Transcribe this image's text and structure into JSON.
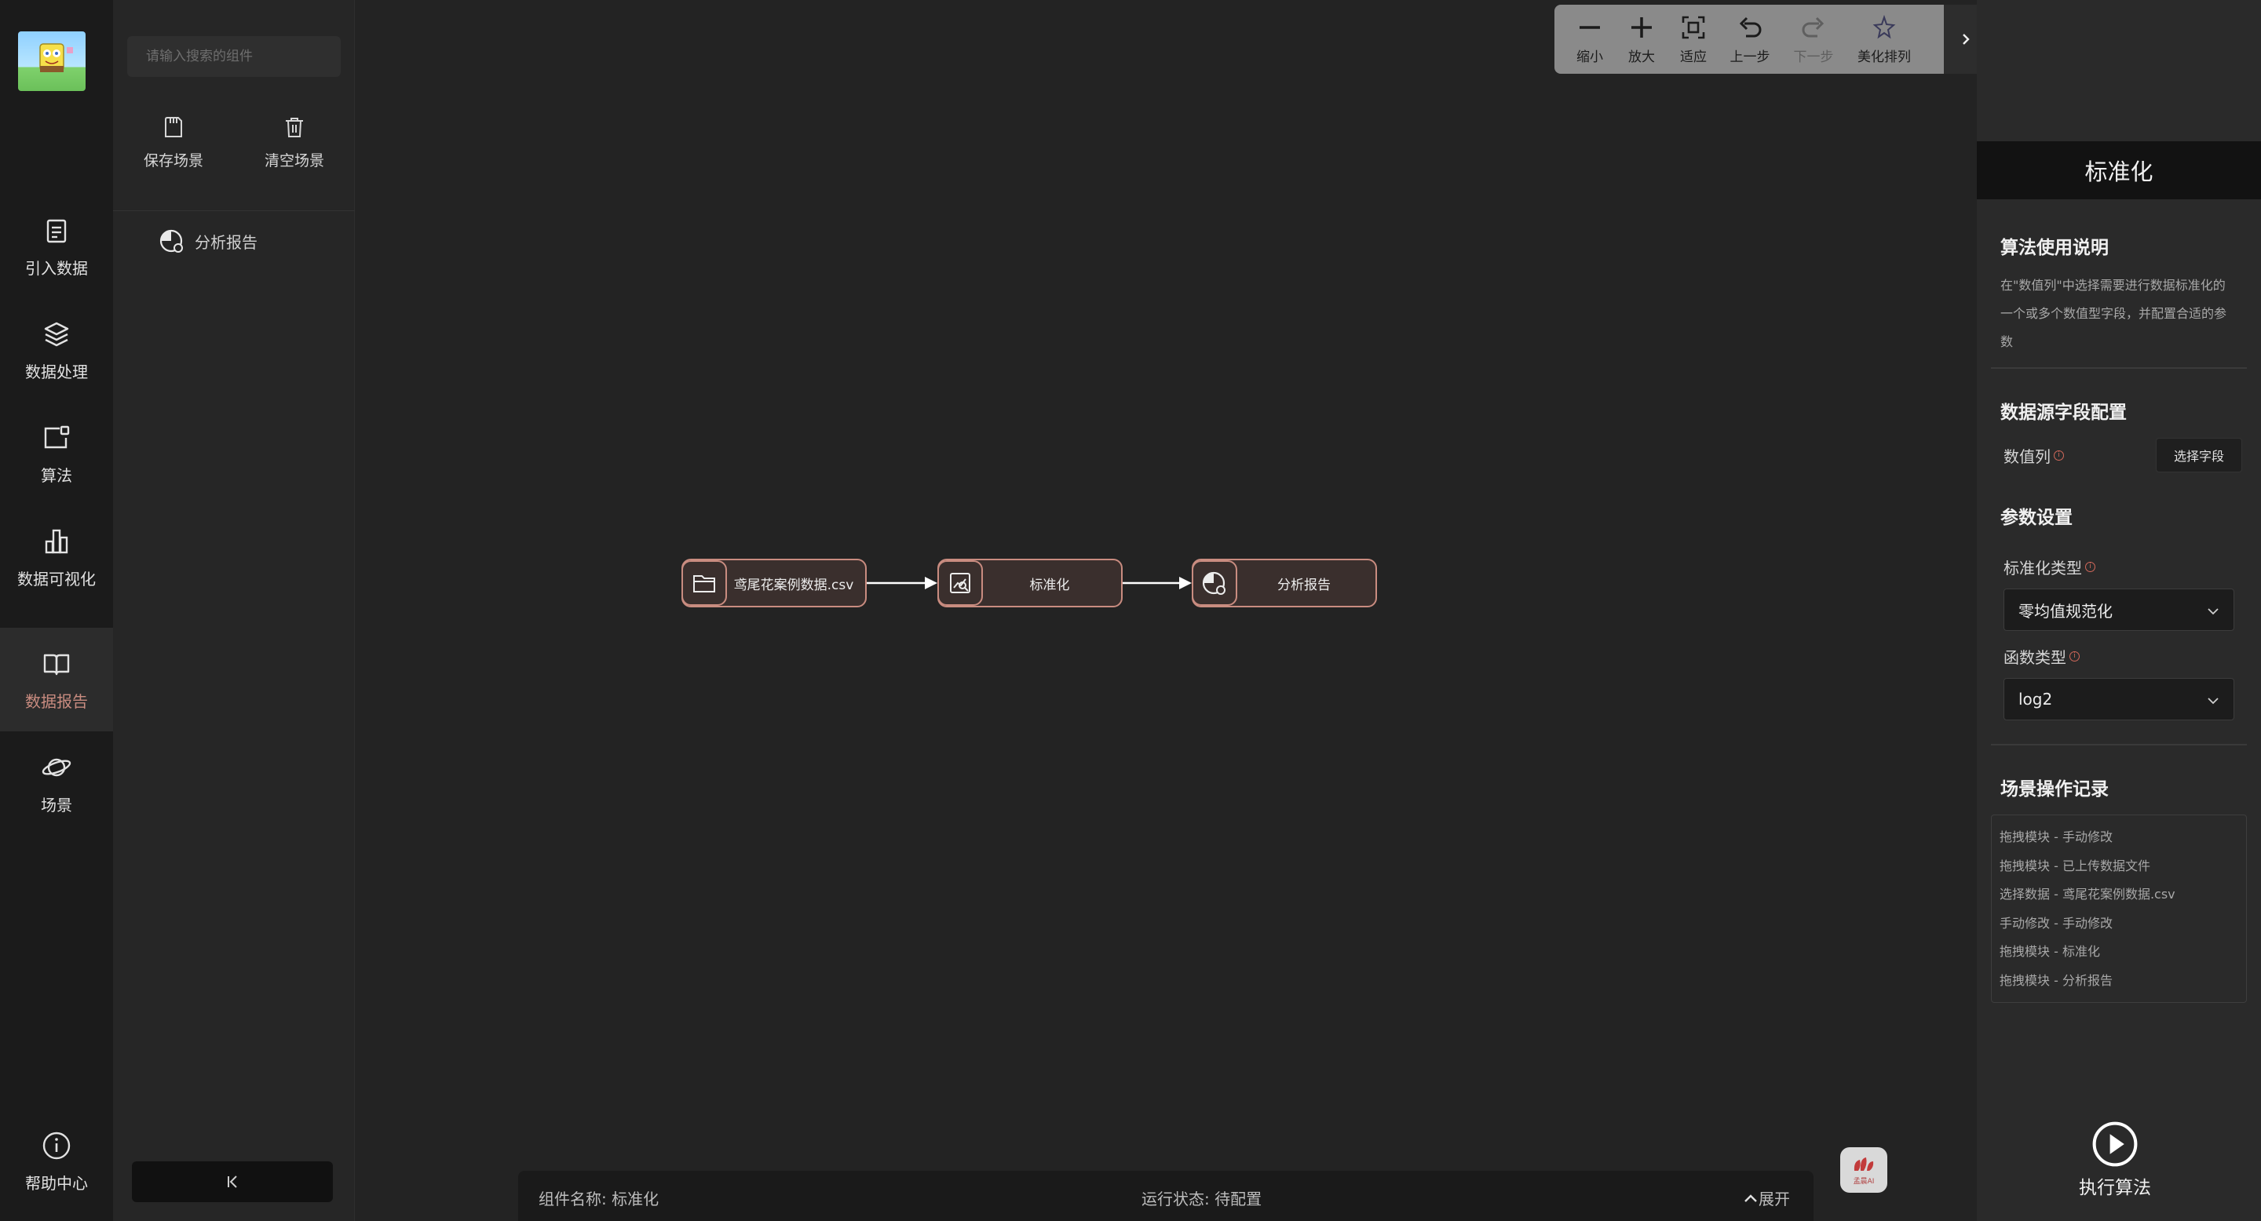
{
  "nav": {
    "items": [
      {
        "label": "引入数据",
        "icon": "clipboard-icon"
      },
      {
        "label": "数据处理",
        "icon": "layers-icon"
      },
      {
        "label": "算法",
        "icon": "algorithm-icon"
      },
      {
        "label": "数据可视化",
        "icon": "bar-chart-icon"
      },
      {
        "label": "数据报告",
        "icon": "book-icon",
        "active": true
      },
      {
        "label": "场景",
        "icon": "planet-icon"
      }
    ],
    "help_label": "帮助中心"
  },
  "panel": {
    "search_placeholder": "请输入搜索的组件",
    "save_label": "保存场景",
    "clear_label": "清空场景",
    "components": [
      {
        "label": "分析报告",
        "icon": "pie-report-icon"
      }
    ]
  },
  "toolbar": {
    "items": [
      {
        "label": "缩小",
        "icon": "minus-icon"
      },
      {
        "label": "放大",
        "icon": "plus-icon"
      },
      {
        "label": "适应",
        "icon": "fit-icon"
      },
      {
        "label": "上一步",
        "icon": "undo-icon"
      },
      {
        "label": "下一步",
        "icon": "redo-icon",
        "disabled": true
      },
      {
        "label": "美化排列",
        "icon": "beautify-icon"
      }
    ]
  },
  "flow": {
    "nodes": [
      {
        "label": "鸢尾花案例数据.csv",
        "icon": "folder-icon"
      },
      {
        "label": "标准化",
        "icon": "standardize-icon"
      },
      {
        "label": "分析报告",
        "icon": "pie-report-icon"
      }
    ]
  },
  "statusbar": {
    "component_name": "组件名称: 标准化",
    "run_status": "运行状态: 待配置",
    "expand_label": "展开"
  },
  "floating_logo_text": "孟晨AI",
  "right": {
    "title": "标准化",
    "usage_title": "算法使用说明",
    "usage_text": "在\"数值列\"中选择需要进行数据标准化的一个或多个数值型字段，并配置合适的参数",
    "source_title": "数据源字段配置",
    "numeric_col_label": "数值列",
    "select_field_label": "选择字段",
    "params_title": "参数设置",
    "std_type_label": "标准化类型",
    "std_type_value": "零均值规范化",
    "func_type_label": "函数类型",
    "func_type_value": "log2",
    "log_title": "场景操作记录",
    "log": [
      "拖拽模块 - 手动修改",
      "拖拽模块 - 已上传数据文件",
      "选择数据 - 鸢尾花案例数据.csv",
      "手动修改 - 手动修改",
      "拖拽模块 - 标准化",
      "拖拽模块 - 分析报告"
    ],
    "run_label": "执行算法"
  },
  "colors": {
    "accent": "#c98c80",
    "toolbar_bg": "#8a8a8a",
    "node_fill": "#3a2f2d"
  }
}
